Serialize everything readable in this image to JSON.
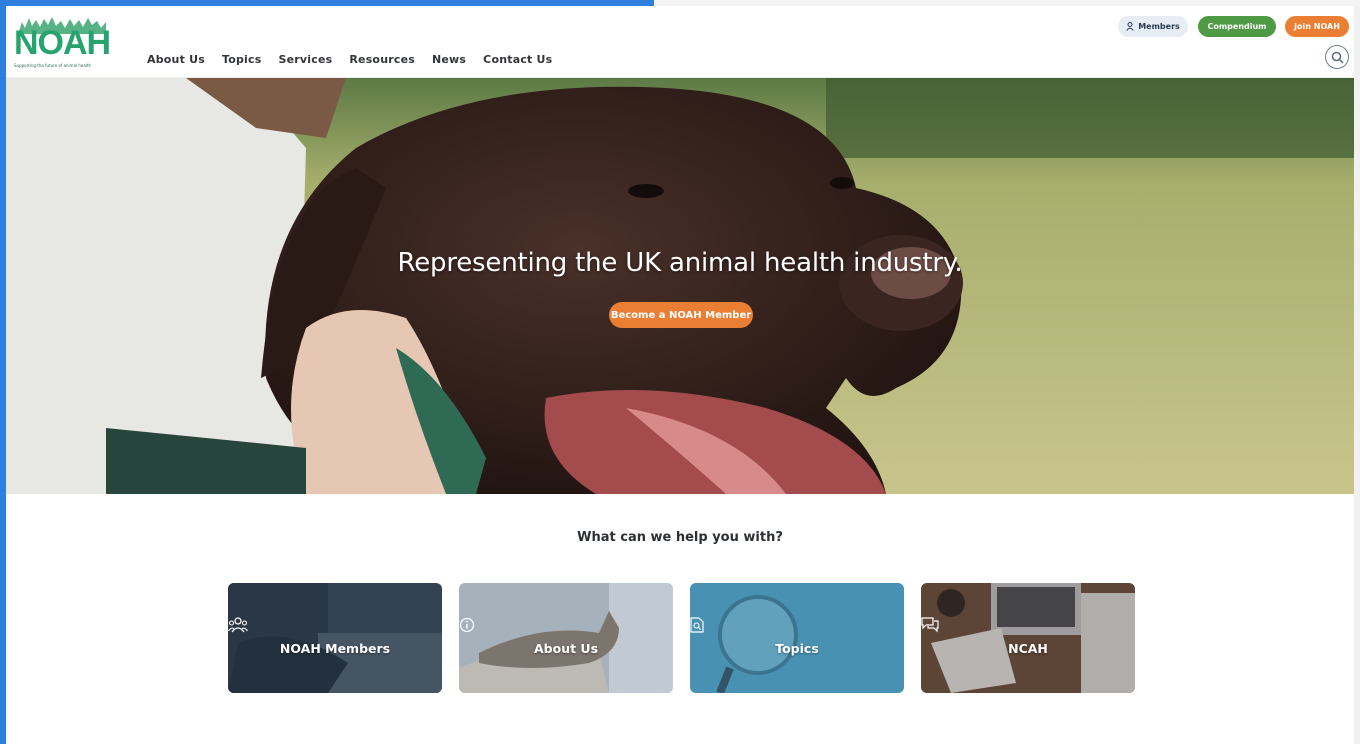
{
  "logo": {
    "text": "NOAH",
    "tagline": "Supporting the future of animal health"
  },
  "nav": [
    {
      "label": "About Us"
    },
    {
      "label": "Topics"
    },
    {
      "label": "Services"
    },
    {
      "label": "Resources"
    },
    {
      "label": "News"
    },
    {
      "label": "Contact Us"
    }
  ],
  "header_buttons": {
    "members": "Members",
    "compendium": "Compendium",
    "join": "Join NOAH"
  },
  "hero": {
    "title": "Representing the UK animal health industry.",
    "cta": "Become a NOAH Member"
  },
  "help": {
    "heading": "What can we help you with?",
    "cards": [
      {
        "label": "NOAH Members",
        "icon": "people-icon"
      },
      {
        "label": "About Us",
        "icon": "info-icon"
      },
      {
        "label": "Topics",
        "icon": "document-search-icon"
      },
      {
        "label": "NCAH",
        "icon": "chat-icon"
      }
    ]
  },
  "colors": {
    "brand_green": "#27a36f",
    "compendium_green": "#4f9a44",
    "accent_orange": "#ea7f34",
    "frame_blue": "#2f7fe0"
  }
}
